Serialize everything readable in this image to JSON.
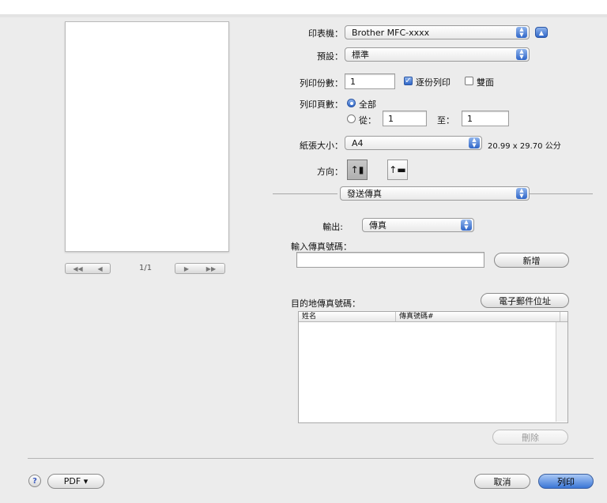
{
  "printer": {
    "label": "印表機：",
    "value": "Brother MFC-xxxx"
  },
  "presets": {
    "label": "預設：",
    "value": "標準"
  },
  "copies": {
    "label": "列印份數：",
    "value": "1",
    "collated_label": "逐份列印",
    "collated_checked": true,
    "two_sided_label": "雙面",
    "two_sided_checked": false
  },
  "pages": {
    "label": "列印頁數：",
    "all_label": "全部",
    "from_label": "從：",
    "from_value": "1",
    "to_label": "至：",
    "to_value": "1"
  },
  "paper": {
    "label": "紙張大小：",
    "value": "A4",
    "dims": "20.99 x 29.70 公分"
  },
  "orientation": {
    "label": "方向："
  },
  "panel": {
    "value": "發送傳真"
  },
  "output": {
    "label": "輸出:",
    "value": "傳真"
  },
  "fax_input": {
    "label": "輸入傳真號碼：",
    "value": "",
    "add_button": "新增"
  },
  "destination": {
    "label": "目的地傳真號碼：",
    "email_button": "電子郵件位址",
    "columns": [
      "姓名",
      "傳真號碼#"
    ],
    "rows": []
  },
  "delete_button": "刪除",
  "pager": {
    "text": "1/1"
  },
  "footer": {
    "help": "?",
    "pdf_button": "PDF ▾",
    "cancel_button": "取消",
    "print_button": "列印"
  },
  "icons": {
    "popup_arrows": "up-down-arrows-icon",
    "disclosure": "triangle-up-icon",
    "portrait": "portrait-orientation-icon",
    "landscape": "landscape-orientation-icon"
  }
}
